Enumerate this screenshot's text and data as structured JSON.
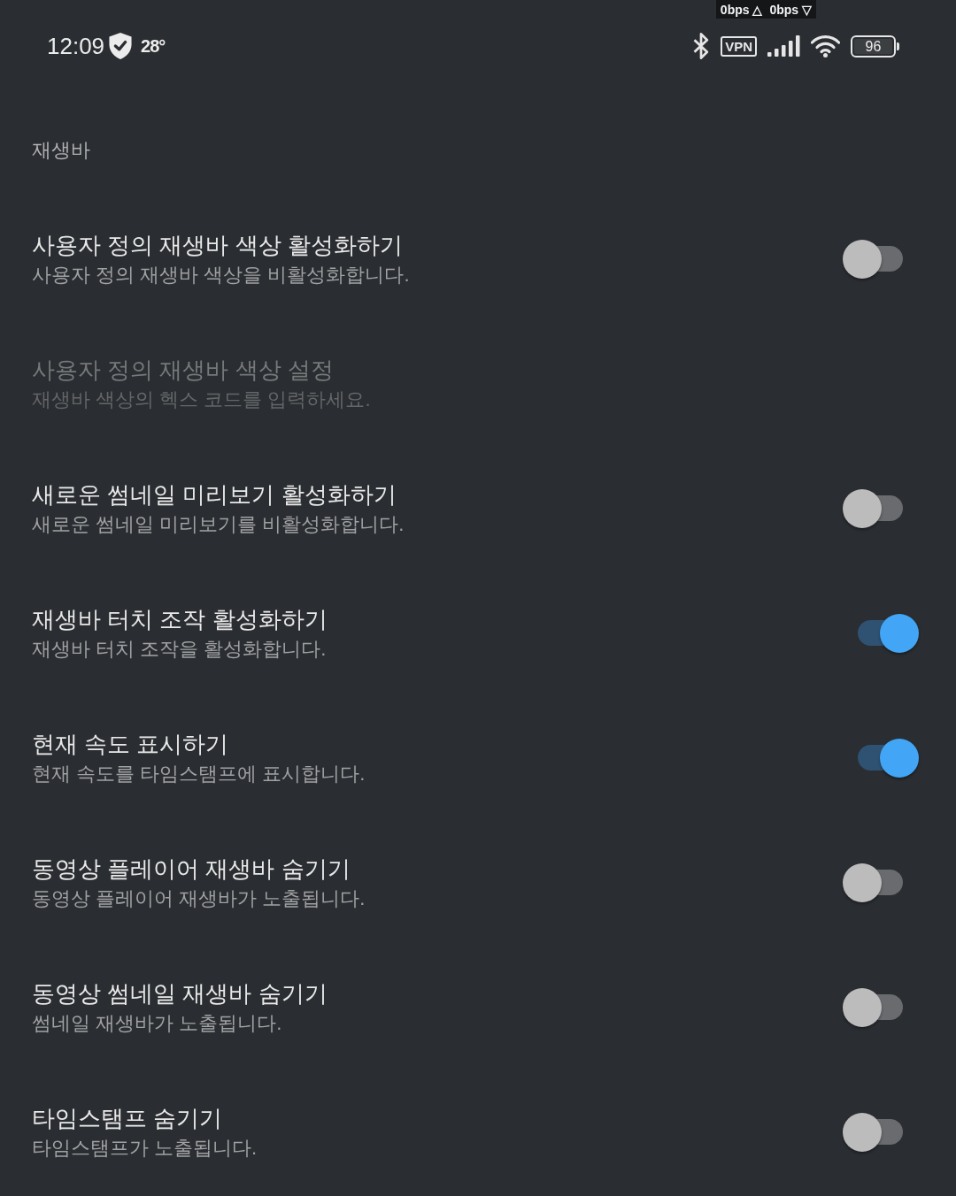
{
  "status_bar": {
    "time": "12:09",
    "temperature": "28°",
    "upload_speed": "0bps △",
    "download_speed": "0bps ▽",
    "vpn": "VPN",
    "battery": "96"
  },
  "section_title": "재생바",
  "settings": [
    {
      "kind": "switch",
      "title": "사용자 정의 재생바 색상 활성화하기",
      "summary": "사용자 정의 재생바 색상을 비활성화합니다.",
      "disabled": false,
      "on": false
    },
    {
      "kind": "text",
      "title": "사용자 정의 재생바 색상 설정",
      "summary": "재생바 색상의 헥스 코드를 입력하세요.",
      "disabled": true
    },
    {
      "kind": "switch",
      "title": "새로운 썸네일 미리보기 활성화하기",
      "summary": "새로운 썸네일 미리보기를 비활성화합니다.",
      "disabled": false,
      "on": false
    },
    {
      "kind": "switch",
      "title": "재생바 터치 조작 활성화하기",
      "summary": "재생바 터치 조작을 활성화합니다.",
      "disabled": false,
      "on": true
    },
    {
      "kind": "switch",
      "title": "현재 속도 표시하기",
      "summary": "현재 속도를 타임스탬프에 표시합니다.",
      "disabled": false,
      "on": true
    },
    {
      "kind": "switch",
      "title": "동영상 플레이어 재생바 숨기기",
      "summary": "동영상 플레이어 재생바가 노출됩니다.",
      "disabled": false,
      "on": false
    },
    {
      "kind": "switch",
      "title": "동영상 썸네일 재생바 숨기기",
      "summary": "썸네일 재생바가 노출됩니다.",
      "disabled": false,
      "on": false
    },
    {
      "kind": "switch",
      "title": "타임스탬프 숨기기",
      "summary": "타임스탬프가 노출됩니다.",
      "disabled": false,
      "on": false
    }
  ]
}
